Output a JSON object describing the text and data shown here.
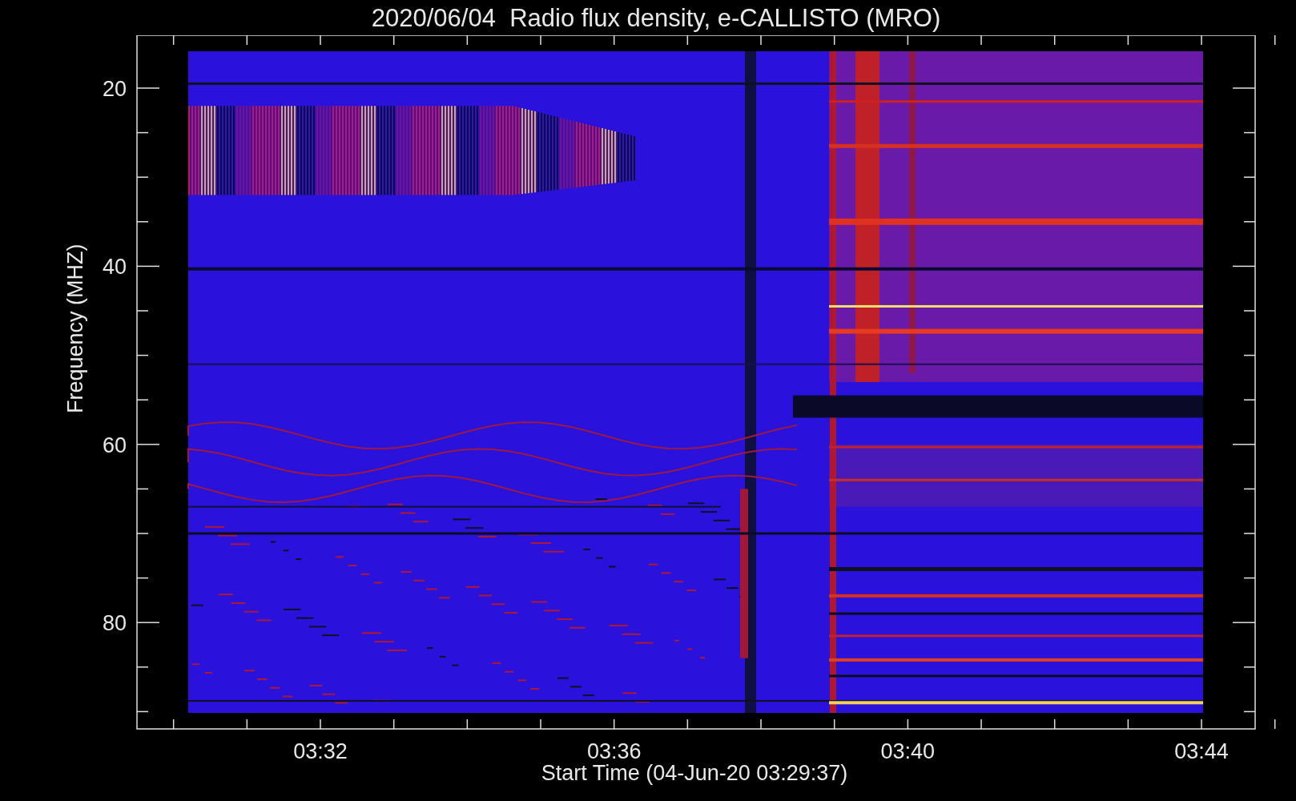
{
  "title": "2020/06/04  Radio flux density, e-CALLISTO (MRO)",
  "y_axis": {
    "label": "Frequency (MHZ)",
    "ticks": [
      "20",
      "40",
      "60",
      "80"
    ]
  },
  "x_axis": {
    "label": "Start Time (04-Jun-20 03:29:37)",
    "ticks": [
      "03:32",
      "03:36",
      "03:40",
      "03:44"
    ]
  }
}
